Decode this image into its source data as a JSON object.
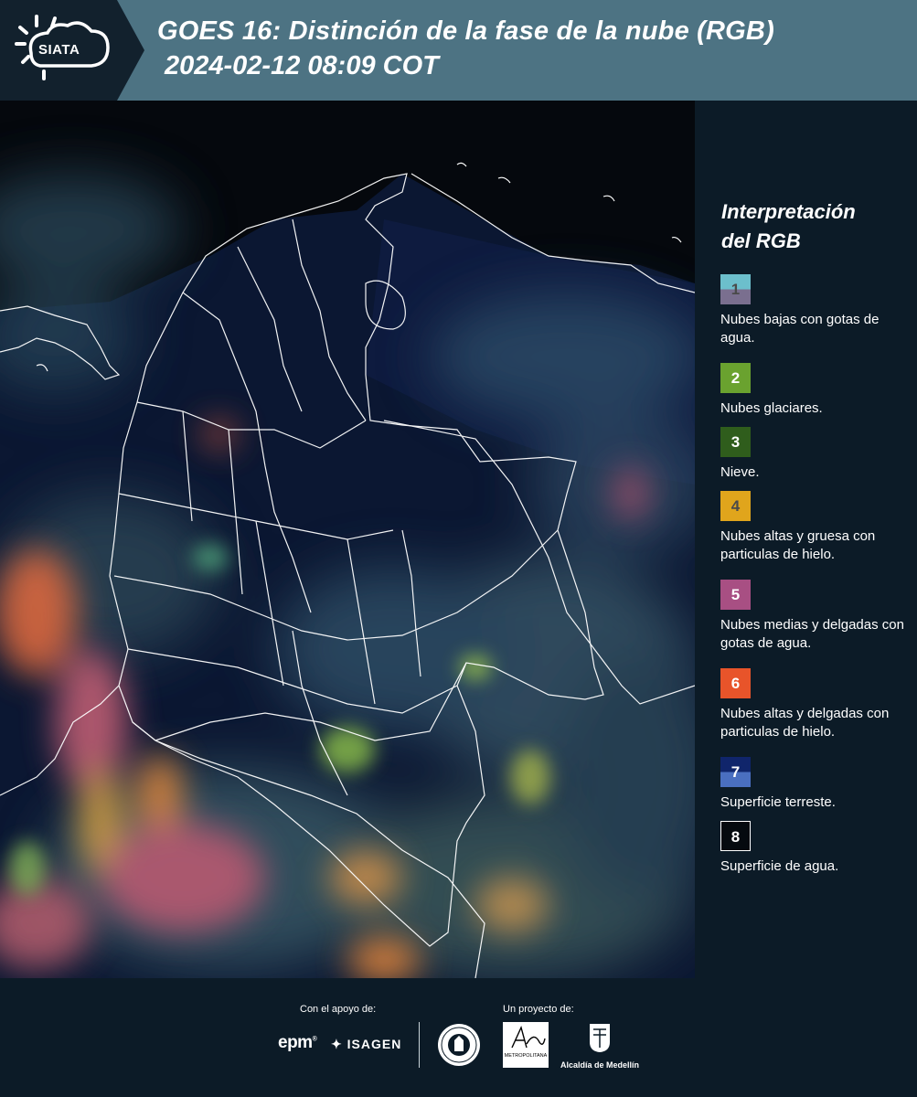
{
  "header": {
    "logo_text": "SIATA",
    "title": "GOES 16: Distinción de la fase de la nube (RGB)",
    "subtitle": "2024-02-12 08:09 COT"
  },
  "map": {
    "icon": "satellite-rgb-composite"
  },
  "legend": {
    "title_line1": "Interpretación",
    "title_line2": "del RGB",
    "items": [
      {
        "num": "1",
        "label": "Nubes bajas con gotas de agua.",
        "color_top": "#6cbfcc",
        "color_bottom": "#7a6f8f",
        "num_color": "#4a4a4a"
      },
      {
        "num": "2",
        "label": "Nubes glaciares.",
        "color_top": "#6aa22f",
        "color_bottom": "#6aa22f",
        "num_color": "#ffffff"
      },
      {
        "num": "3",
        "label": "Nieve.",
        "color_top": "#2f5d1c",
        "color_bottom": "#2f5d1c",
        "num_color": "#ffffff"
      },
      {
        "num": "4",
        "label": "Nubes altas y gruesa con particulas de hielo.",
        "color_top": "#e0a51c",
        "color_bottom": "#e0a51c",
        "num_color": "#4a4a4a"
      },
      {
        "num": "5",
        "label": "Nubes medias y delgadas con gotas de agua.",
        "color_top": "#a84f83",
        "color_bottom": "#a84f83",
        "num_color": "#ffffff"
      },
      {
        "num": "6",
        "label": "Nubes altas y delgadas con particulas de hielo.",
        "color_top": "#e8542a",
        "color_bottom": "#e8542a",
        "num_color": "#ffffff"
      },
      {
        "num": "7",
        "label": "Superficie terreste.",
        "color_top": "#10256b",
        "color_bottom": "#4a6fc0",
        "num_color": "#ffffff"
      },
      {
        "num": "8",
        "label": "Superficie de agua.",
        "color_top": "#050a0f",
        "color_bottom": "#050a0f",
        "num_color": "#ffffff"
      }
    ]
  },
  "footer": {
    "support_label": "Con el apoyo de:",
    "project_label": "Un proyecto de:",
    "epm": "epm",
    "isagen": "ISAGEN",
    "area_text": "METROPOLITANA",
    "alcaldia": "Alcaldía de Medellín"
  }
}
